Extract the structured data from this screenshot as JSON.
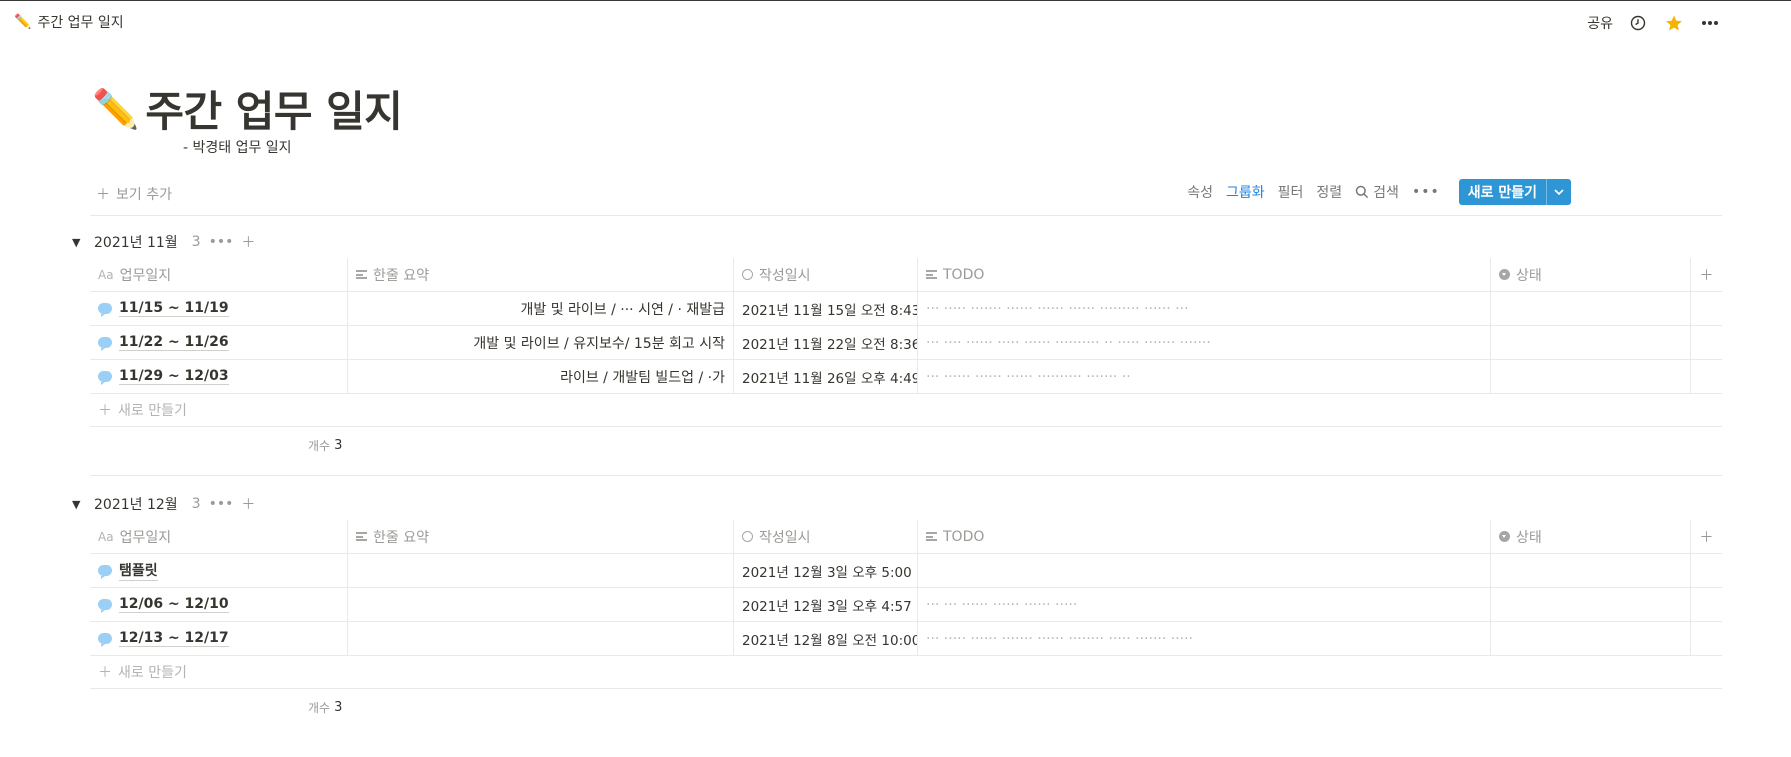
{
  "breadcrumb": {
    "emoji": "✏️",
    "title": "주간 업무 일지"
  },
  "topbar": {
    "share_label": "공유"
  },
  "page": {
    "emoji": "✏️",
    "title": "주간 업무 일지",
    "subtitle": "- 박경태 업무 일지"
  },
  "viewbar": {
    "add_view": "보기 추가",
    "properties": "속성",
    "group": "그룹화",
    "filter": "필터",
    "sort": "정렬",
    "search": "검색",
    "new_button": "새로 만들기"
  },
  "columns": {
    "title": "업무일지",
    "summary": "한줄 요약",
    "created": "작성일시",
    "todo": "TODO",
    "status": "상태"
  },
  "groups": [
    {
      "name": "2021년 11월",
      "count": "3",
      "rows": [
        {
          "title": "11/15 ~ 11/19",
          "summary": "개발 및 라이브 / ··· 시연 / ·                재발급",
          "created": "2021년 11월 15일 오전 8:43",
          "todo": "··· ····· ······· ······ ······ ······ ········· ······ ···",
          "status": ""
        },
        {
          "title": "11/22 ~ 11/26",
          "summary": "개발 및 라이브 /             유지보수/ 15분 회고 시작",
          "created": "2021년 11월 22일 오전 8:36",
          "todo": "··· ···· ······ ····· ······ ·········· ·· ····· ······· ·······",
          "status": ""
        },
        {
          "title": "11/29 ~ 12/03",
          "summary": "라이브 / 개발팀 빌드업 /                              ·가",
          "created": "2021년 11월 26일 오후 4:49",
          "todo": "··· ······ ······ ······ ·········· ······· ··",
          "status": ""
        }
      ],
      "new_label": "새로 만들기",
      "count_label": "개수",
      "count_value": "3"
    },
    {
      "name": "2021년 12월",
      "count": "3",
      "rows": [
        {
          "title": "탬플릿",
          "summary": "",
          "created": "2021년 12월 3일 오후 5:00",
          "todo": "",
          "status": ""
        },
        {
          "title": "12/06 ~ 12/10",
          "summary": "",
          "created": "2021년 12월 3일 오후 4:57",
          "todo": "··· ···            ······ ······ ······ ·····",
          "status": ""
        },
        {
          "title": "12/13 ~ 12/17",
          "summary": "",
          "created": "2021년 12월 8일 오전 10:00",
          "todo": "··· ····· ······ ······· ······ ········ ····· ······· ·····",
          "status": ""
        }
      ],
      "new_label": "새로 만들기",
      "count_label": "개수",
      "count_value": "3"
    }
  ],
  "colors": {
    "accent": "#2383e2",
    "button": "#2f96d6",
    "star": "#f5b400"
  }
}
